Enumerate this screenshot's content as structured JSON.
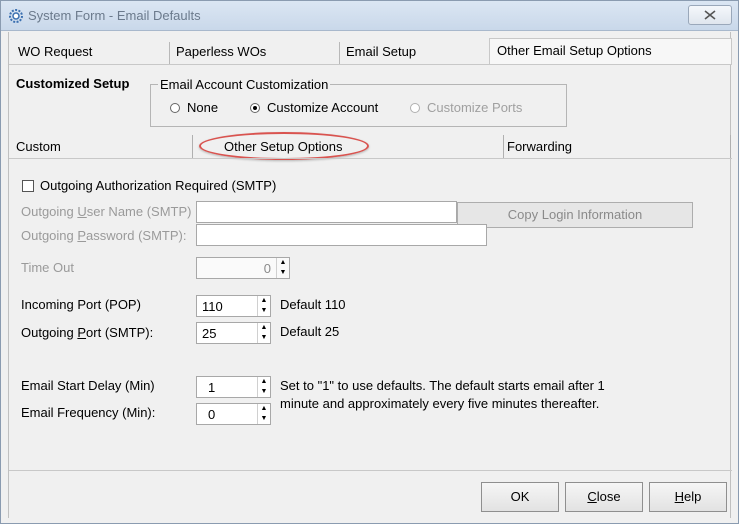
{
  "window": {
    "title": "System Form - Email Defaults"
  },
  "tabs_primary": [
    {
      "label": "WO Request"
    },
    {
      "label": "Paperless WOs"
    },
    {
      "label": "Email Setup"
    },
    {
      "label": "Other Email Setup Options",
      "active": true
    }
  ],
  "customized_setup_label": "Customized Setup",
  "account_customization": {
    "title": "Email Account Customization",
    "options": [
      {
        "label": "None",
        "selected": false,
        "enabled": true
      },
      {
        "label": "Customize Account",
        "selected": true,
        "enabled": true
      },
      {
        "label": "Customize Ports",
        "selected": false,
        "enabled": false
      }
    ]
  },
  "tabs_secondary": [
    {
      "label": "Custom"
    },
    {
      "label": "Other Setup Options",
      "active": true
    },
    {
      "label": "Forwarding"
    }
  ],
  "form": {
    "auth_checkbox": {
      "label": "Outgoing  Authorization Required (SMTP)",
      "checked": false
    },
    "user_name": {
      "label_pre": "Outgoing ",
      "label_u": "U",
      "label_post": "ser Name (SMTP)",
      "value": ""
    },
    "password": {
      "label_pre": "Outgoing  ",
      "label_u": "P",
      "label_post": "assword (SMTP):",
      "value": ""
    },
    "copy_login_button": "Copy Login Information",
    "time_out": {
      "label": "Time Out",
      "value": "0"
    },
    "incoming_port": {
      "label": "Incoming Port (POP)",
      "value": "110",
      "default_text": "Default 110"
    },
    "outgoing_port": {
      "label_pre": "Outgoing ",
      "label_u": "P",
      "label_post": "ort (SMTP):",
      "value": "25",
      "default_text": "Default 25"
    },
    "start_delay": {
      "label": "Email Start Delay (Min)",
      "value": "1"
    },
    "frequency": {
      "label": "Email Frequency (Min):",
      "value": "0"
    },
    "help_line1": "Set to \"1\" to use defaults. The default starts email after 1",
    "help_line2": "minute  and approximately every five minutes thereafter."
  },
  "buttons": {
    "ok": "OK",
    "close_pre": "",
    "close_u": "C",
    "close_post": "lose",
    "help_pre": "",
    "help_u": "H",
    "help_post": "elp"
  },
  "colors": {
    "highlight": "#d9534f"
  }
}
